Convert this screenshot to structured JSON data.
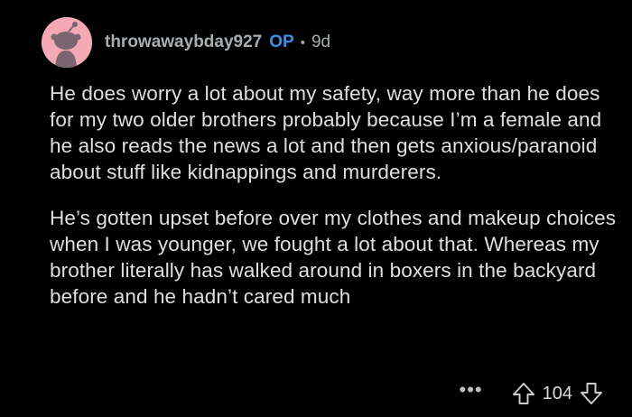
{
  "comment": {
    "username": "throwawaybday927",
    "op_badge": "OP",
    "separator": "•",
    "age": "9d",
    "paragraphs": [
      "He does worry a lot about my safety, way more than he does for my two older brothers probably because I’m a female and he also reads the news a lot and then gets anxious/paranoid about stuff like kidnappings and murderers.",
      "He’s gotten upset before over my clothes and makeup choices when I was younger, we fought a lot about that. Whereas my brother literally has walked around in boxers in the backyard before and he hadn’t cared much"
    ]
  },
  "actions": {
    "more": "•••",
    "vote_count": "104",
    "upvote_icon": "arrow-up-outline-icon",
    "downvote_icon": "arrow-down-outline-icon"
  },
  "colors": {
    "background": "#000000",
    "avatar_bg": "#f4a9b5",
    "op": "#3d8fe6",
    "text": "#dedfe0",
    "meta": "#a9adb0"
  }
}
